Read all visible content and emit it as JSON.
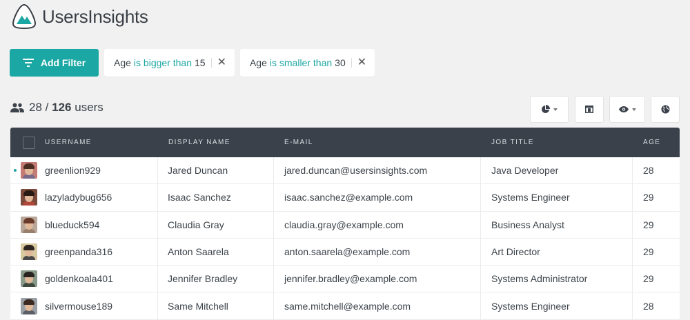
{
  "app": {
    "name": "UsersInsights"
  },
  "filters": {
    "add_label": "Add Filter",
    "items": [
      {
        "field": "Age",
        "operator": "is bigger than",
        "value": "15"
      },
      {
        "field": "Age",
        "operator": "is smaller than",
        "value": "30"
      }
    ]
  },
  "summary": {
    "shown": "28",
    "separator": "/",
    "total": "126",
    "unit": "users"
  },
  "table": {
    "columns": [
      "USERNAME",
      "DISPLAY NAME",
      "E-MAIL",
      "JOB TITLE",
      "AGE"
    ],
    "rows": [
      {
        "username": "greenlion929",
        "display_name": "Jared Duncan",
        "email": "jared.duncan@usersinsights.com",
        "job_title": "Java Developer",
        "age": "28",
        "online": true,
        "avatar": {
          "bg": "#c47b74",
          "hair": "#4a2e22",
          "shirt": "#7a6a8a"
        }
      },
      {
        "username": "lazyladybug656",
        "display_name": "Isaac Sanchez",
        "email": "isaac.sanchez@example.com",
        "job_title": "Systems Engineer",
        "age": "29",
        "online": false,
        "avatar": {
          "bg": "#7a4a3a",
          "hair": "#2a1a14",
          "shirt": "#b0473a"
        }
      },
      {
        "username": "blueduck594",
        "display_name": "Claudia Gray",
        "email": "claudia.gray@example.com",
        "job_title": "Business Analyst",
        "age": "29",
        "online": false,
        "avatar": {
          "bg": "#b9a89a",
          "hair": "#6a3a2a",
          "shirt": "#9a7f6a"
        }
      },
      {
        "username": "greenpanda316",
        "display_name": "Anton Saarela",
        "email": "anton.saarela@example.com",
        "job_title": "Art Director",
        "age": "29",
        "online": false,
        "avatar": {
          "bg": "#d9c9a0",
          "hair": "#2e2620",
          "shirt": "#4a4a4a"
        }
      },
      {
        "username": "goldenkoala401",
        "display_name": "Jennifer Bradley",
        "email": "jennifer.bradley@example.com",
        "job_title": "Systems Administrator",
        "age": "29",
        "online": false,
        "avatar": {
          "bg": "#8a9a8a",
          "hair": "#2a2420",
          "shirt": "#3e4a3e"
        }
      },
      {
        "username": "silvermouse189",
        "display_name": "Same Mitchell",
        "email": "same.mitchell@example.com",
        "job_title": "Systems Engineer",
        "age": "28",
        "online": false,
        "avatar": {
          "bg": "#9aa0a6",
          "hair": "#3a2a22",
          "shirt": "#5a5f66"
        }
      }
    ]
  },
  "toolbar": {
    "icons": [
      "segments-pie-icon",
      "columns-icon",
      "visibility-icon",
      "globe-icon"
    ]
  },
  "colors": {
    "accent": "#1ba7a3",
    "header_bg": "#3a414b"
  }
}
